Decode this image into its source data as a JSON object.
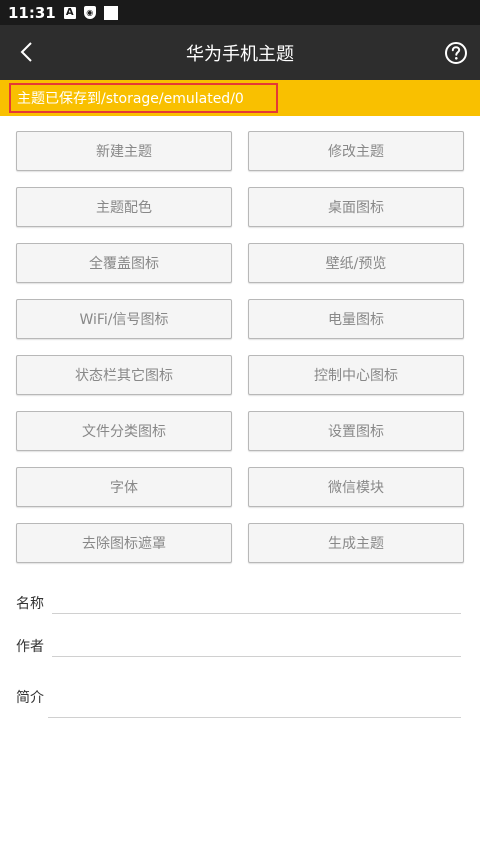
{
  "status_bar": {
    "time": "11:31",
    "icons": [
      "a-notification-icon",
      "shield-icon",
      "square-icon"
    ]
  },
  "header": {
    "title": "华为手机主题",
    "back_icon": "chevron-left-icon",
    "help_icon": "help-circle-icon"
  },
  "notice": {
    "text": "主题已保存到/storage/emulated/0",
    "bg_color": "#f9c000",
    "border_color": "#e53935"
  },
  "buttons": [
    "新建主题",
    "修改主题",
    "主题配色",
    "桌面图标",
    "全覆盖图标",
    "壁纸/预览",
    "WiFi/信号图标",
    "电量图标",
    "状态栏其它图标",
    "控制中心图标",
    "文件分类图标",
    "设置图标",
    "字体",
    "微信模块",
    "去除图标遮罩",
    "生成主题"
  ],
  "form": {
    "name_label": "名称",
    "author_label": "作者",
    "intro_label": "简介",
    "name_value": "",
    "author_value": "",
    "intro_value": ""
  }
}
